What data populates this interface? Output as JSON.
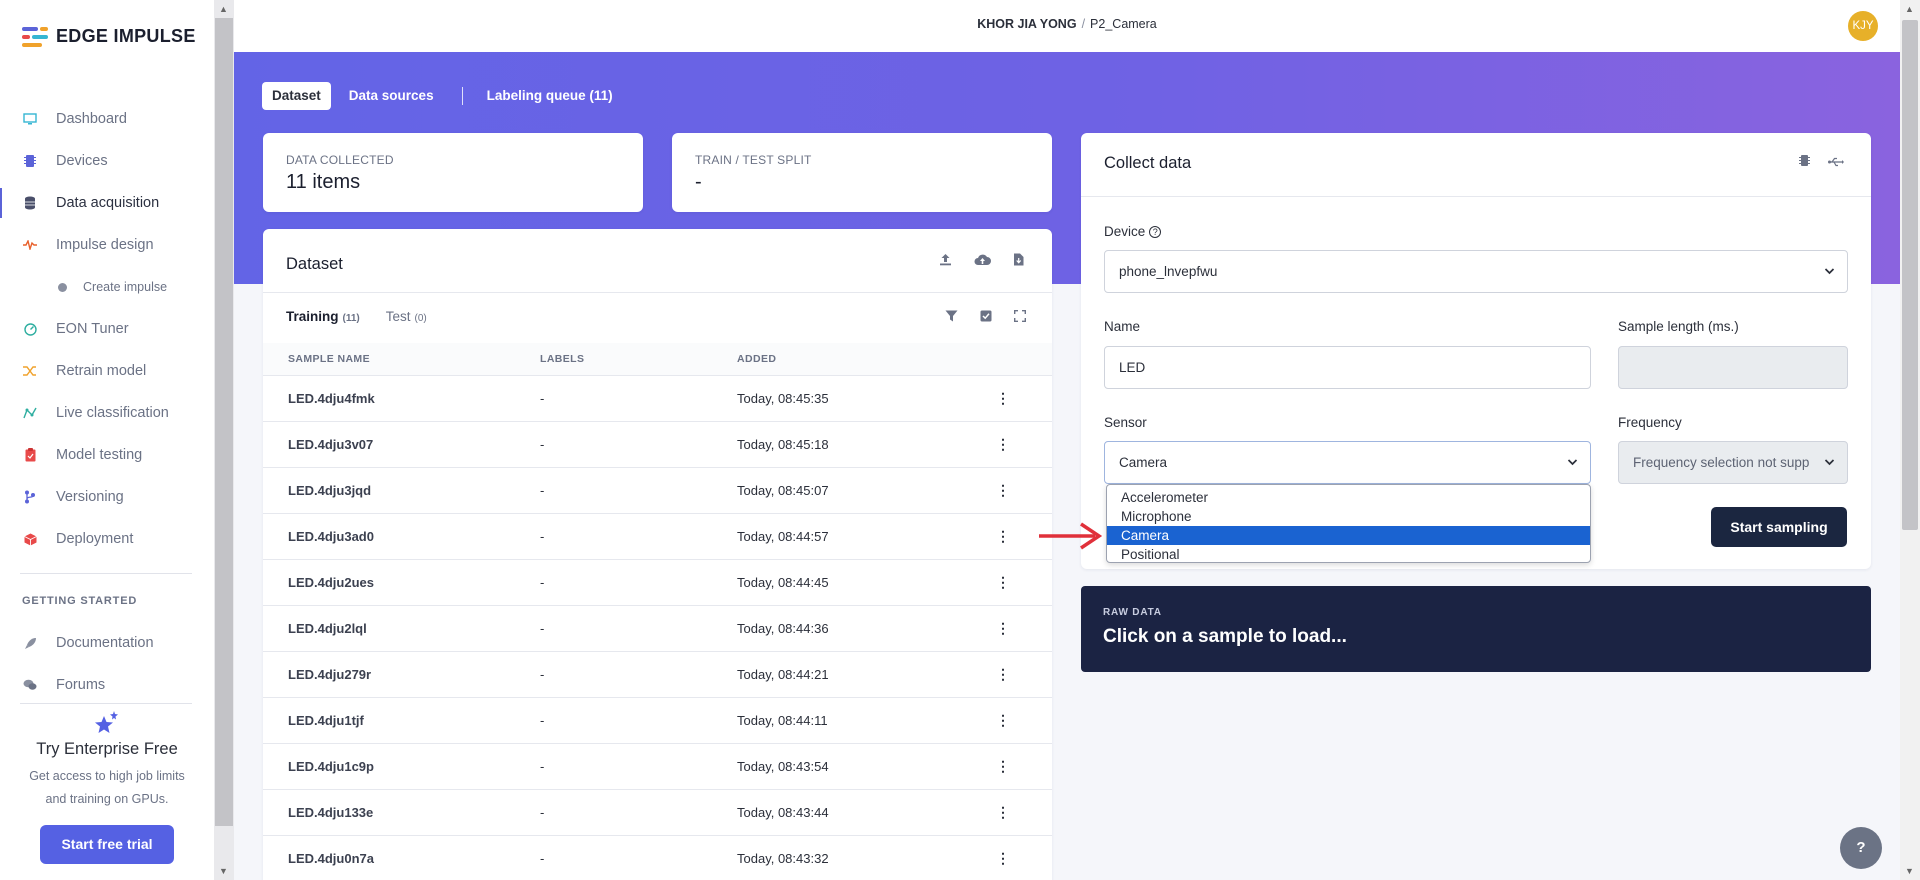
{
  "brand": {
    "name": "EDGE IMPULSE"
  },
  "sidebar": {
    "items": [
      {
        "label": "Dashboard",
        "icon": "monitor-icon"
      },
      {
        "label": "Devices",
        "icon": "chip-icon"
      },
      {
        "label": "Data acquisition",
        "icon": "database-icon"
      },
      {
        "label": "Impulse design",
        "icon": "waveform-icon"
      },
      {
        "label": "Create impulse",
        "icon": "dot-icon"
      },
      {
        "label": "EON Tuner",
        "icon": "tuner-icon"
      },
      {
        "label": "Retrain model",
        "icon": "shuffle-icon"
      },
      {
        "label": "Live classification",
        "icon": "graph-icon"
      },
      {
        "label": "Model testing",
        "icon": "clipboard-icon"
      },
      {
        "label": "Versioning",
        "icon": "branch-icon"
      },
      {
        "label": "Deployment",
        "icon": "box-icon"
      }
    ],
    "getting_started_label": "GETTING STARTED",
    "getting_started": [
      {
        "label": "Documentation",
        "icon": "rocket-icon"
      },
      {
        "label": "Forums",
        "icon": "chat-icon"
      }
    ],
    "promo": {
      "title": "Try Enterprise Free",
      "text_line1": "Get access to high job limits",
      "text_line2": "and training on GPUs.",
      "button": "Start free trial"
    }
  },
  "header": {
    "user": "KHOR JIA YONG",
    "separator": "/",
    "project": "P2_Camera",
    "avatar_initials": "KJY"
  },
  "tabs": [
    "Dataset",
    "Data sources",
    "Labeling queue (11)"
  ],
  "stats": {
    "data_collected_label": "DATA COLLECTED",
    "data_collected_value": "11 items",
    "split_label": "TRAIN / TEST SPLIT",
    "split_value": "-"
  },
  "dataset": {
    "title": "Dataset",
    "training_label": "Training",
    "training_count": "(11)",
    "test_label": "Test",
    "test_count": "(0)",
    "columns": [
      "SAMPLE NAME",
      "LABELS",
      "ADDED"
    ],
    "rows": [
      {
        "name": "LED.4dju4fmk",
        "label": "-",
        "added": "Today, 08:45:35"
      },
      {
        "name": "LED.4dju3v07",
        "label": "-",
        "added": "Today, 08:45:18"
      },
      {
        "name": "LED.4dju3jqd",
        "label": "-",
        "added": "Today, 08:45:07"
      },
      {
        "name": "LED.4dju3ad0",
        "label": "-",
        "added": "Today, 08:44:57"
      },
      {
        "name": "LED.4dju2ues",
        "label": "-",
        "added": "Today, 08:44:45"
      },
      {
        "name": "LED.4dju2lql",
        "label": "-",
        "added": "Today, 08:44:36"
      },
      {
        "name": "LED.4dju279r",
        "label": "-",
        "added": "Today, 08:44:21"
      },
      {
        "name": "LED.4dju1tjf",
        "label": "-",
        "added": "Today, 08:44:11"
      },
      {
        "name": "LED.4dju1c9p",
        "label": "-",
        "added": "Today, 08:43:54"
      },
      {
        "name": "LED.4dju133e",
        "label": "-",
        "added": "Today, 08:43:44"
      },
      {
        "name": "LED.4dju0n7a",
        "label": "-",
        "added": "Today, 08:43:32"
      }
    ]
  },
  "collect": {
    "title": "Collect data",
    "device_label": "Device",
    "device_value": "phone_lnvepfwu",
    "name_label": "Name",
    "name_value": "LED",
    "sample_length_label": "Sample length (ms.)",
    "sample_length_value": "",
    "sensor_label": "Sensor",
    "sensor_value": "Camera",
    "frequency_label": "Frequency",
    "frequency_value": "Frequency selection not supp",
    "start_button": "Start sampling",
    "sensor_options": [
      "Accelerometer",
      "Microphone",
      "Camera",
      "Positional"
    ],
    "selected_option": "Camera"
  },
  "raw_data": {
    "label": "RAW DATA",
    "text": "Click on a sample to load..."
  },
  "help_label": "?",
  "colors": {
    "accent": "#5561e3",
    "hero_start": "#6364e6",
    "hero_end": "#8a63df",
    "dark_button": "#1b2640",
    "selection": "#1a63d1",
    "annotation_arrow": "#e0303a"
  }
}
